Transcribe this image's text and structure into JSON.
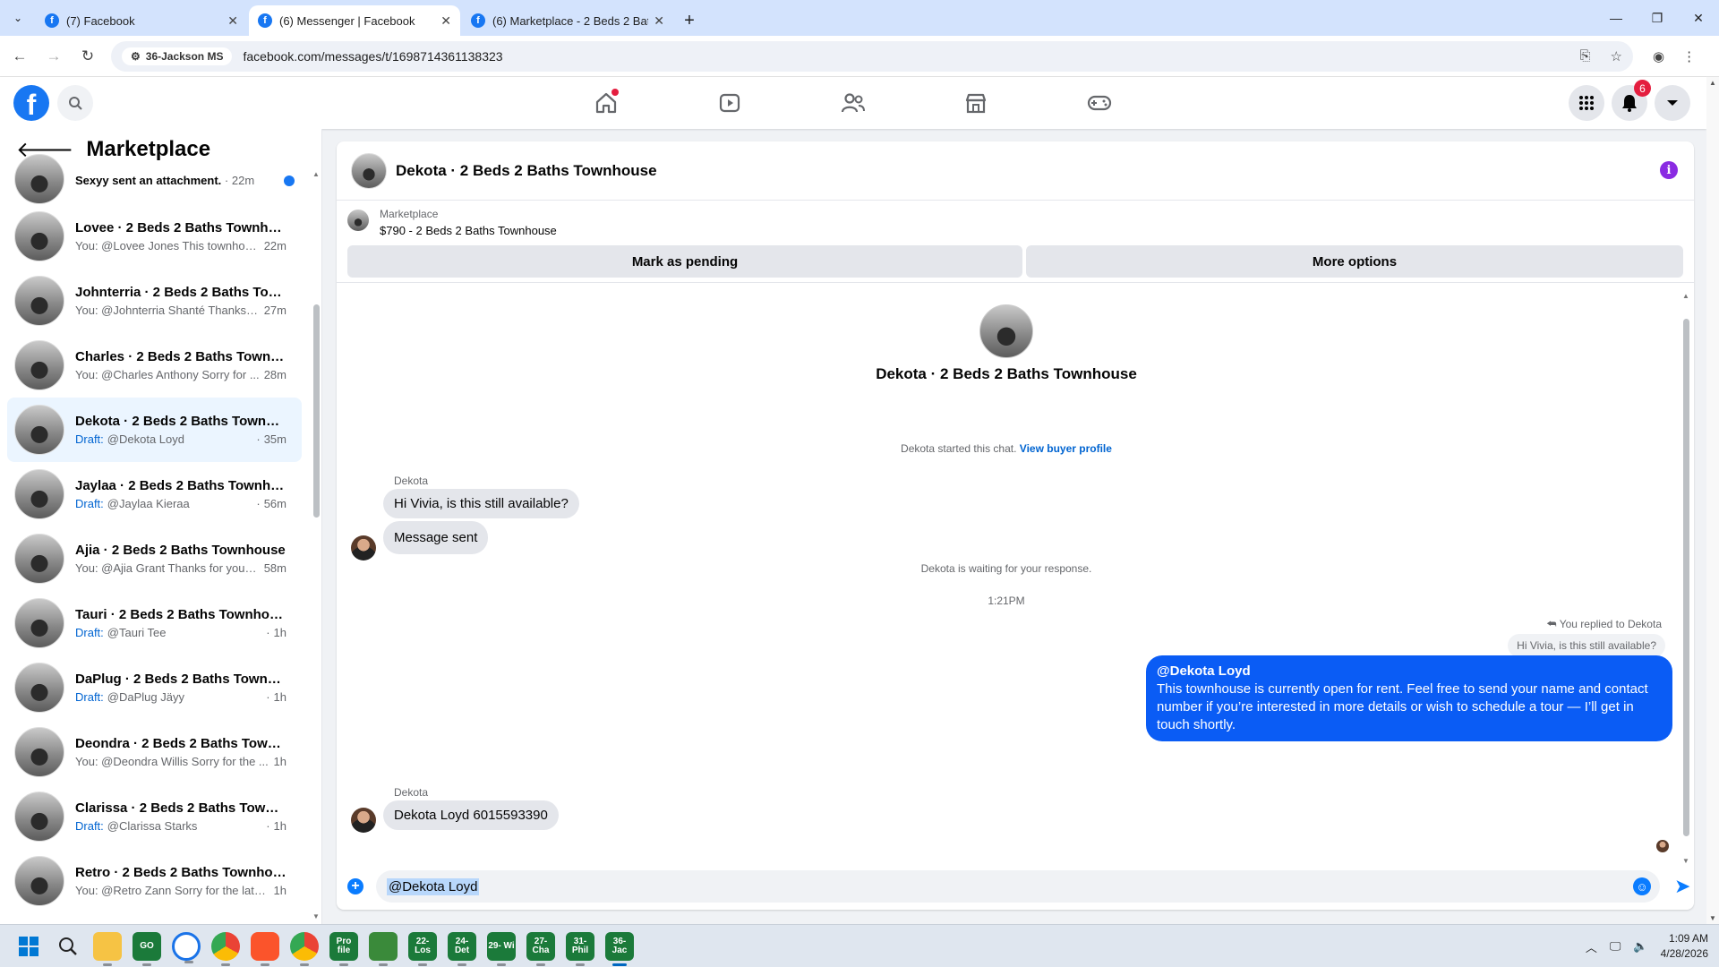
{
  "browser": {
    "tabs": [
      {
        "title": "(7) Facebook",
        "active": false
      },
      {
        "title": "(6) Messenger | Facebook",
        "active": true
      },
      {
        "title": "(6) Marketplace - 2 Beds 2 Bath",
        "active": false
      }
    ],
    "site_chip": "36-Jackson MS",
    "url": "facebook.com/messages/t/1698714361138323"
  },
  "fbnav": {
    "notifications_count": "6"
  },
  "sidebar": {
    "title": "Marketplace",
    "partial_item": {
      "sub": "Sexyy sent an attachment.",
      "time": "22m"
    },
    "items": [
      {
        "name": "Lovee · 2 Beds 2 Baths Townhouse",
        "draft": "",
        "preview": "You: @Lovee Jones This townhou...",
        "time": "22m"
      },
      {
        "name": "Johnterria · 2 Beds 2 Baths Town...",
        "draft": "",
        "preview": "You: @Johnterria Shanté Thanks f...",
        "time": "27m"
      },
      {
        "name": "Charles · 2 Beds 2 Baths Townho...",
        "draft": "",
        "preview": "You: @Charles Anthony Sorry for ...",
        "time": "28m"
      },
      {
        "name": "Dekota · 2 Beds 2 Baths Townho...",
        "draft": "Draft:",
        "preview": "@Dekota Loyd",
        "time": "35m"
      },
      {
        "name": "Jaylaa · 2 Beds 2 Baths Townhouse",
        "draft": "Draft:",
        "preview": "@Jaylaa Kieraa",
        "time": "56m"
      },
      {
        "name": "Ajia · 2 Beds 2 Baths Townhouse",
        "draft": "",
        "preview": "You: @Ajia Grant Thanks for your ...",
        "time": "58m"
      },
      {
        "name": "Tauri · 2 Beds 2 Baths Townhouse",
        "draft": "Draft:",
        "preview": "@Tauri Tee",
        "time": "1h"
      },
      {
        "name": "DaPlug · 2 Beds 2 Baths Townho...",
        "draft": "Draft:",
        "preview": "@DaPlug Jäyy",
        "time": "1h"
      },
      {
        "name": "Deondra · 2 Beds 2 Baths Townh...",
        "draft": "",
        "preview": "You: @Deondra Willis Sorry for the ...",
        "time": "1h"
      },
      {
        "name": "Clarissa · 2 Beds 2 Baths Townho...",
        "draft": "Draft:",
        "preview": "@Clarissa Starks",
        "time": "1h"
      },
      {
        "name": "Retro · 2 Beds 2 Baths Townhouse",
        "draft": "",
        "preview": "You: @Retro Zann Sorry for the late...",
        "time": "1h"
      }
    ]
  },
  "chat": {
    "title": "Dekota · 2 Beds 2 Baths Townhouse",
    "listing": {
      "category": "Marketplace",
      "name": "$790 - 2 Beds 2 Baths Townhouse",
      "mark_pending_label": "Mark as pending",
      "more_options_label": "More options"
    },
    "hero_name": "Dekota · 2 Beds 2 Baths Townhouse",
    "started_text": "Dekota started this chat.",
    "view_profile_label": "View buyer profile",
    "sender_name": "Dekota",
    "msg1": "Hi Vivia, is this still available?",
    "msg2": "Message sent",
    "waiting_text": "Dekota is waiting for your response.",
    "timestamp": "1:21PM",
    "reply_label": "You replied to Dekota",
    "reply_quote": "Hi Vivia, is this still available?",
    "out_mention": "@Dekota Loyd",
    "out_text": "This townhouse is currently open for rent. Feel free to send your name and contact number if you’re interested in more details or wish to schedule a tour — I’ll get in touch shortly.",
    "sender_name2": "Dekota",
    "msg3": "Dekota Loyd 6015593390",
    "composer_value": "@Dekota Loyd"
  },
  "taskbar": {
    "apps": [
      "GO",
      "Pro file",
      "22- Los",
      "24- Det",
      "29- Wi",
      "27- Cha",
      "31- Phil",
      "36- Jac"
    ],
    "time": "1:09 AM",
    "date": "4/28/2026"
  }
}
